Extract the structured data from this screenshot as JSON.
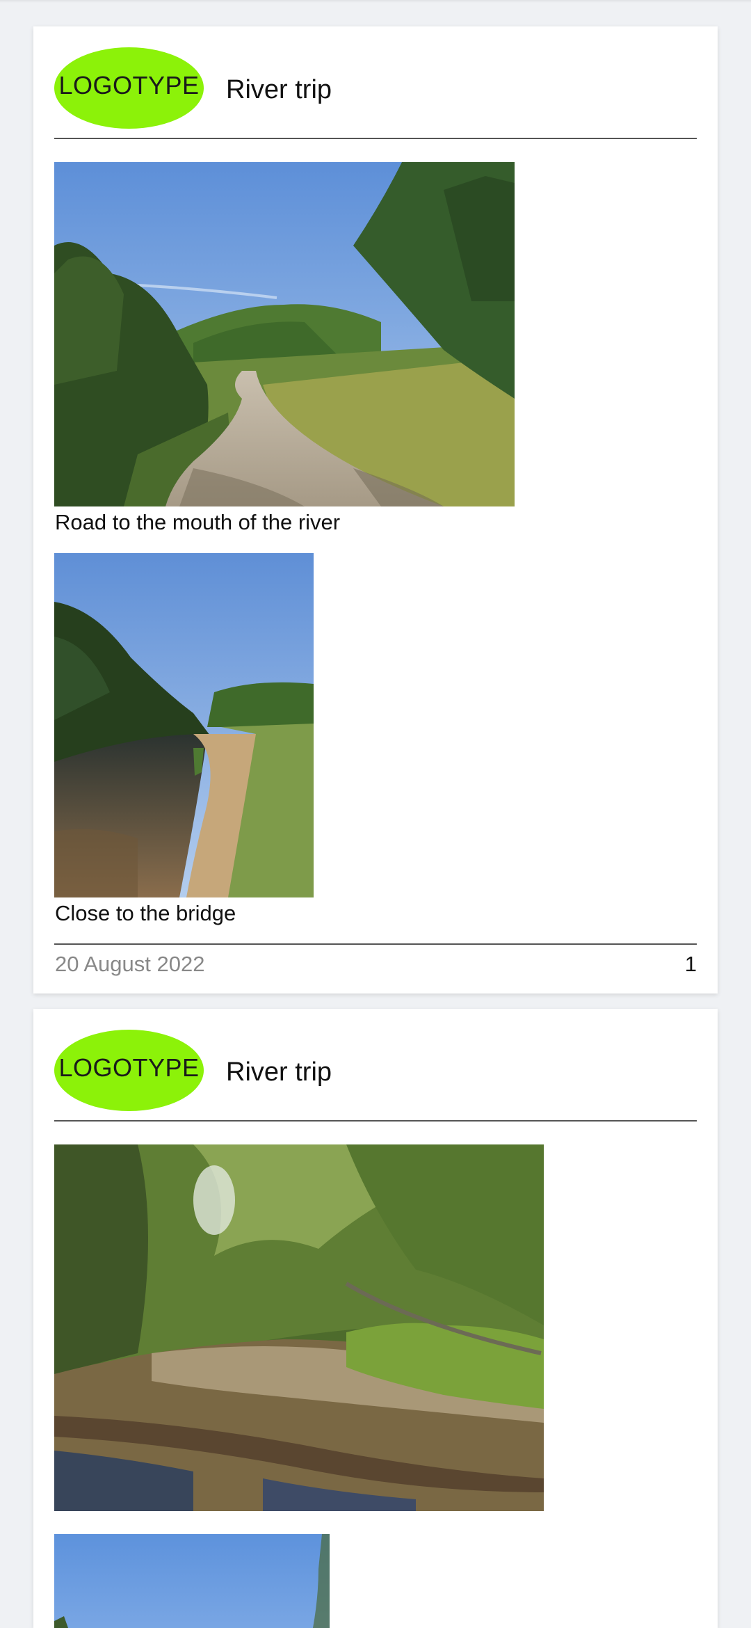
{
  "posts": [
    {
      "logo_text": "LOGOTYPE",
      "title": "River trip",
      "photos": [
        {
          "caption": "Road to the mouth of the river",
          "subject": "gravel road through hills"
        },
        {
          "caption": "Close to the bridge",
          "subject": "river bank with sandy shore"
        }
      ],
      "date": "20 August 2022",
      "page": "1"
    },
    {
      "logo_text": "LOGOTYPE",
      "title": "River trip",
      "photos": [
        {
          "caption": "",
          "subject": "forest stream with fallen log"
        },
        {
          "caption": "",
          "subject": "sky and tree edge"
        }
      ]
    }
  ],
  "colors": {
    "logo": "#8cf209",
    "background": "#eff1f4",
    "card": "#ffffff",
    "date_text": "#888888"
  }
}
